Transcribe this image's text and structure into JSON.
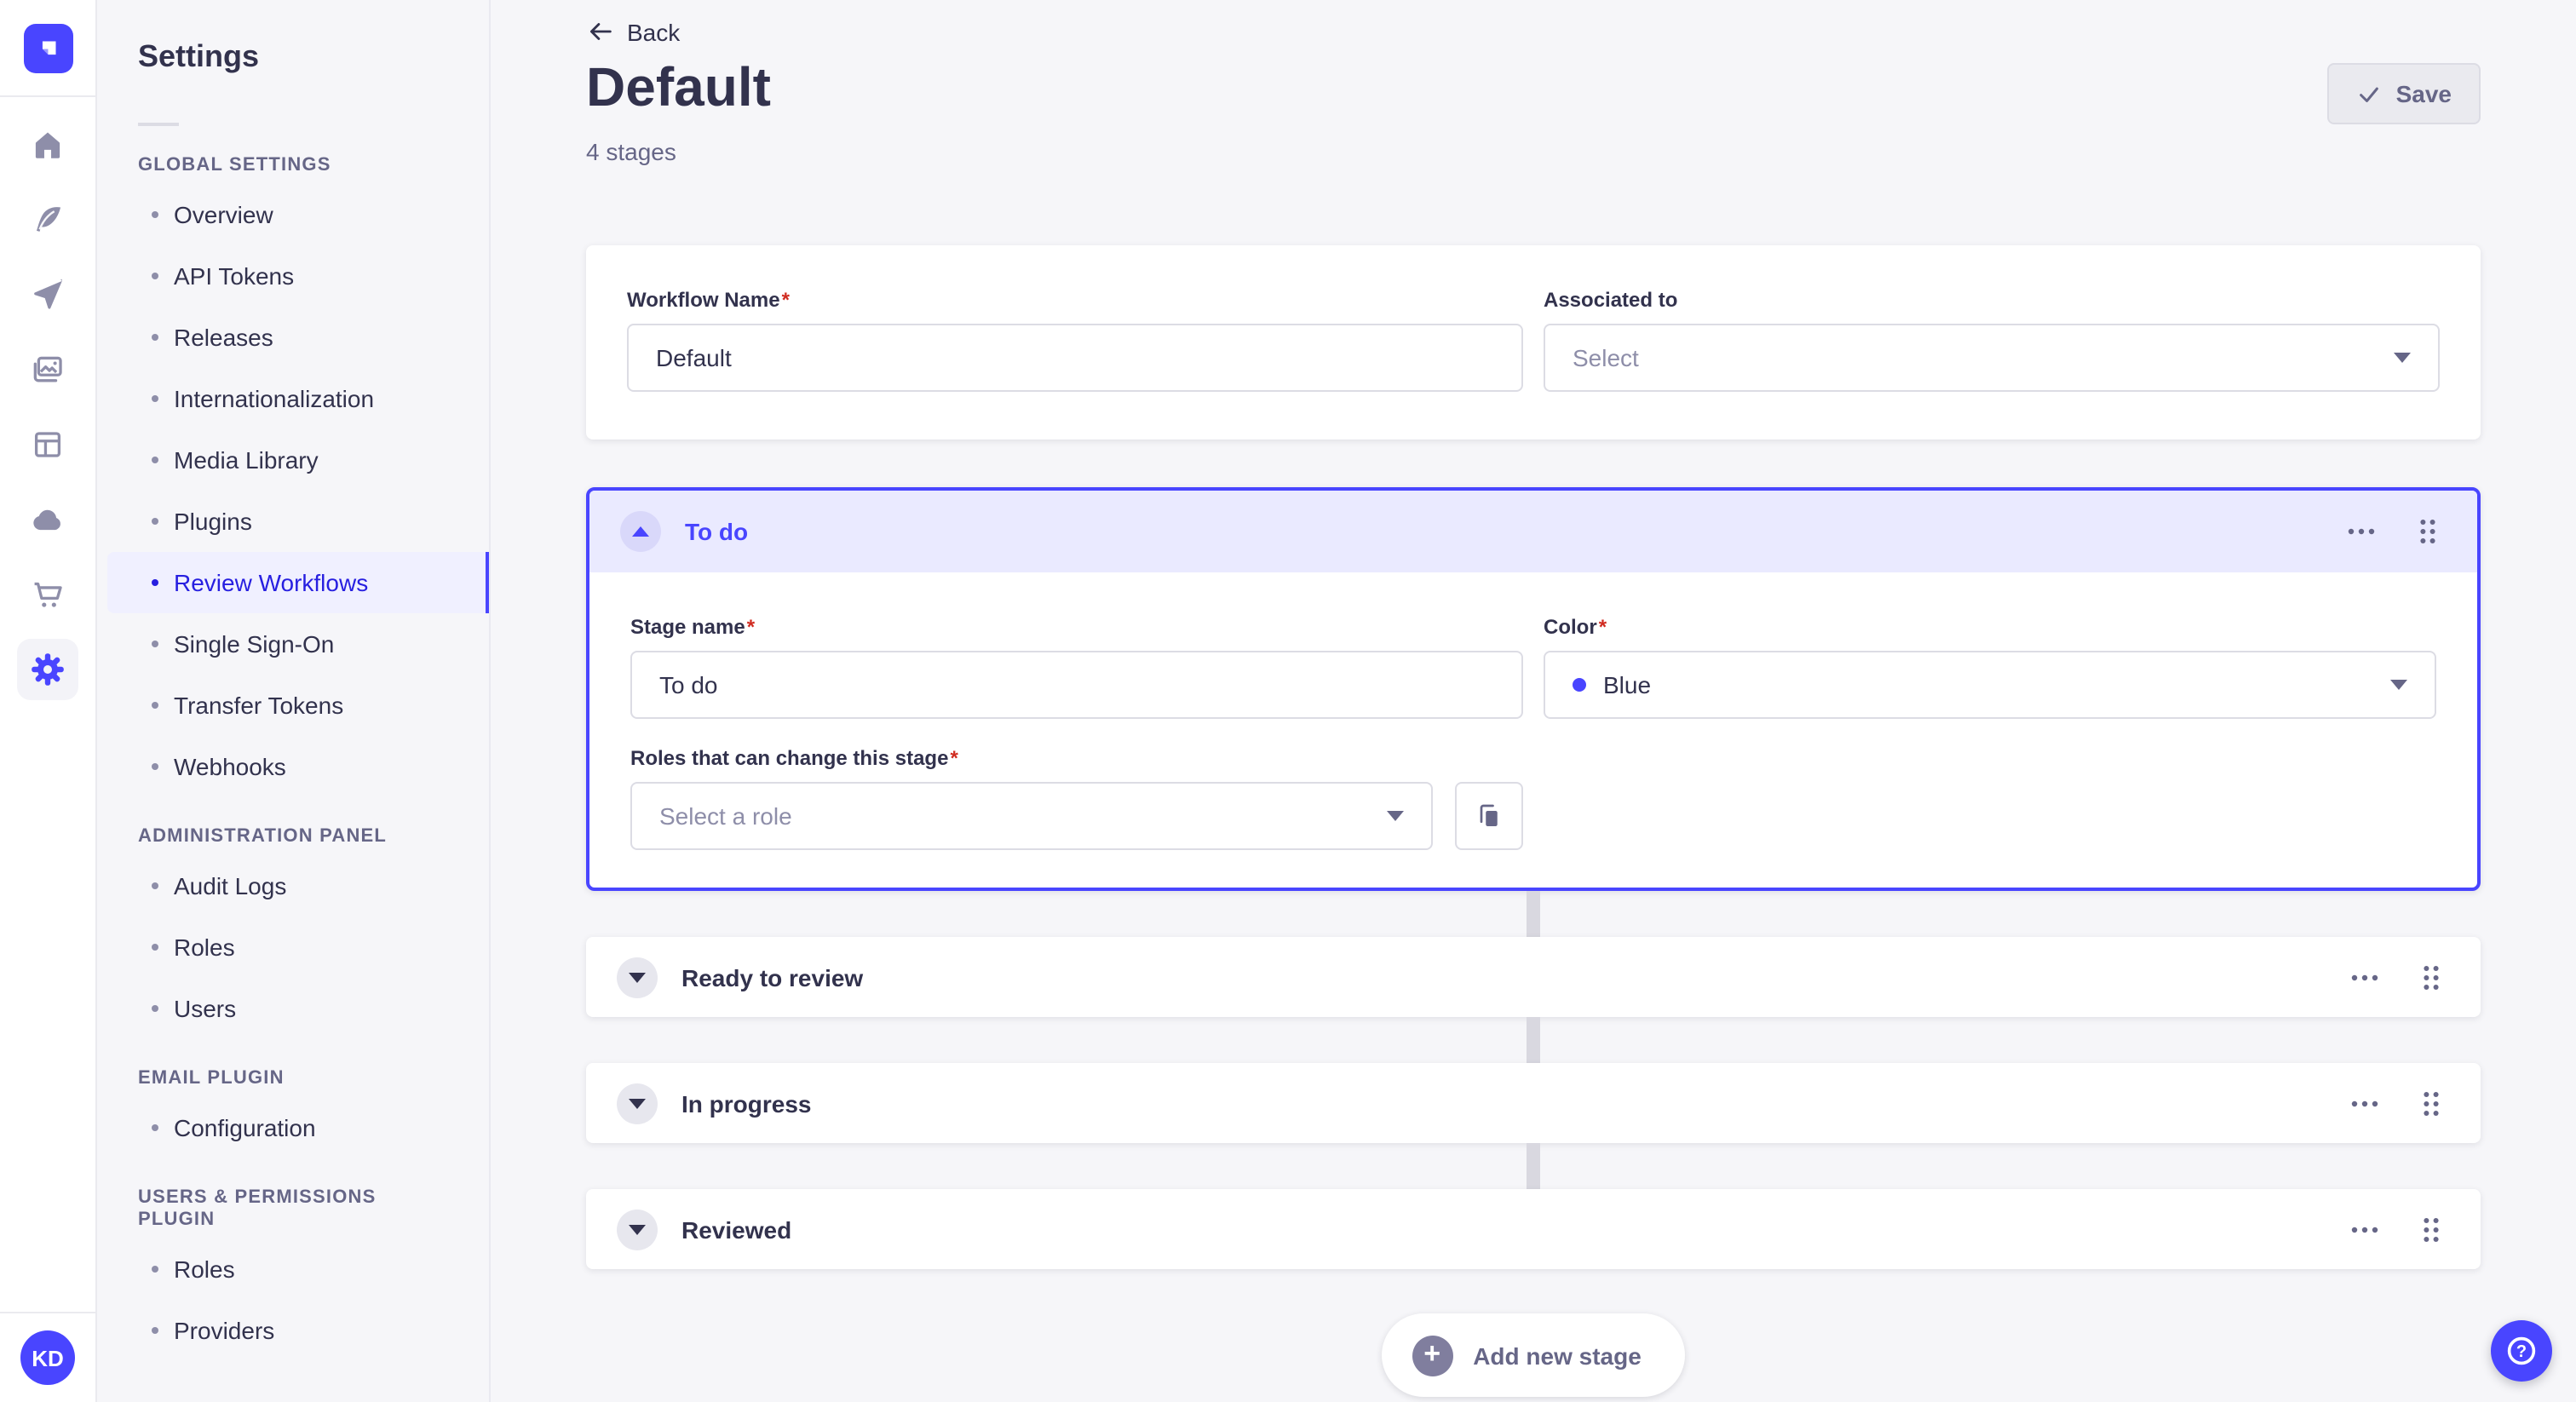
{
  "colors": {
    "accent": "#4945ff",
    "accent_dark": "#271fe0",
    "active_item_bg": "#f0f0ff",
    "stage_header_bg": "#eaeaff",
    "stage_blue_dot": "#4945ff",
    "page_bg": "#f6f6f9",
    "connector": "#d9d8e0",
    "required_asterisk": "#d02b20"
  },
  "rail": {
    "items": [
      {
        "id": "home",
        "icon": "home"
      },
      {
        "id": "content",
        "icon": "feather"
      },
      {
        "id": "releases",
        "icon": "paper-plane"
      },
      {
        "id": "media",
        "icon": "pictures"
      },
      {
        "id": "content-type-builder",
        "icon": "layout"
      },
      {
        "id": "deploy",
        "icon": "cloud"
      },
      {
        "id": "marketplace",
        "icon": "cart"
      },
      {
        "id": "settings",
        "icon": "gear",
        "active": true
      }
    ]
  },
  "user": {
    "initials": "KD"
  },
  "sidebar": {
    "title": "Settings",
    "sections": [
      {
        "heading": "GLOBAL SETTINGS",
        "items": [
          {
            "id": "overview",
            "label": "Overview"
          },
          {
            "id": "api-tokens",
            "label": "API Tokens"
          },
          {
            "id": "releases",
            "label": "Releases"
          },
          {
            "id": "internationalization",
            "label": "Internationalization"
          },
          {
            "id": "media-library",
            "label": "Media Library"
          },
          {
            "id": "plugins",
            "label": "Plugins"
          },
          {
            "id": "review-workflows",
            "label": "Review Workflows",
            "active": true
          },
          {
            "id": "single-sign-on",
            "label": "Single Sign-On"
          },
          {
            "id": "transfer-tokens",
            "label": "Transfer Tokens"
          },
          {
            "id": "webhooks",
            "label": "Webhooks"
          }
        ]
      },
      {
        "heading": "ADMINISTRATION PANEL",
        "items": [
          {
            "id": "audit-logs",
            "label": "Audit Logs"
          },
          {
            "id": "admin-roles",
            "label": "Roles"
          },
          {
            "id": "users",
            "label": "Users"
          }
        ]
      },
      {
        "heading": "EMAIL PLUGIN",
        "items": [
          {
            "id": "email-configuration",
            "label": "Configuration"
          }
        ]
      },
      {
        "heading": "USERS & PERMISSIONS PLUGIN",
        "items": [
          {
            "id": "up-roles",
            "label": "Roles"
          },
          {
            "id": "providers",
            "label": "Providers"
          }
        ]
      }
    ]
  },
  "header": {
    "back": "Back",
    "title": "Default",
    "subtitle": "4 stages",
    "save": "Save"
  },
  "form": {
    "workflow_name": {
      "label": "Workflow Name",
      "value": "Default"
    },
    "associated_to": {
      "label": "Associated to",
      "placeholder": "Select"
    }
  },
  "stages": {
    "expanded": {
      "name": "To do",
      "stage_name": {
        "label": "Stage name",
        "value": "To do"
      },
      "color": {
        "label": "Color",
        "value": "Blue",
        "hex": "#4945ff"
      },
      "roles": {
        "label": "Roles that can change this stage",
        "placeholder": "Select a role"
      }
    },
    "collapsed": [
      {
        "name": "Ready to review"
      },
      {
        "name": "In progress"
      },
      {
        "name": "Reviewed"
      }
    ]
  },
  "add_stage_label": "Add new stage"
}
